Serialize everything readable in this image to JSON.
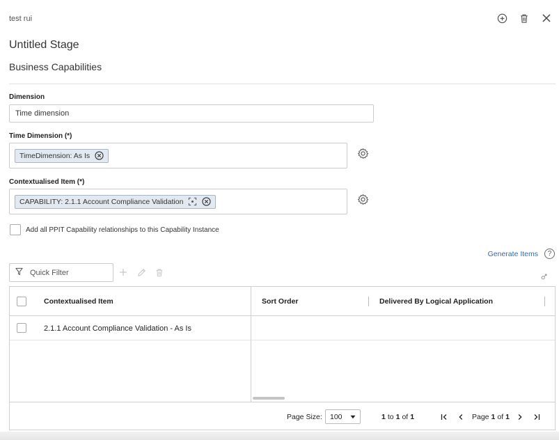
{
  "window": {
    "title": "test rui"
  },
  "header": {
    "stage_title": "Untitled Stage",
    "subtitle": "Business Capabilities"
  },
  "form": {
    "dimension": {
      "label": "Dimension",
      "value": "Time dimension"
    },
    "time_dimension": {
      "label": "Time Dimension (*)",
      "chip": "TimeDimension: As Is"
    },
    "contextualised_item": {
      "label": "Contextualised Item (*)",
      "chip": "CAPABILITY: 2.1.1 Account Compliance Validation"
    },
    "add_all_checkbox": {
      "label": "Add all PPIT Capability relationships to this Capability Instance",
      "checked": false
    }
  },
  "actions": {
    "generate_items": "Generate Items",
    "help": "?"
  },
  "toolbar": {
    "quick_filter_placeholder": "Quick Filter"
  },
  "grid": {
    "columns": [
      "Contextualised Item",
      "Sort Order",
      "Delivered By Logical Application"
    ],
    "rows": [
      {
        "contextualised_item": "2.1.1 Account Compliance Validation - As Is",
        "sort_order": "",
        "delivered_by": ""
      }
    ]
  },
  "pagination": {
    "page_size_label": "Page Size:",
    "page_size": "100",
    "range_from": "1",
    "range_to_word": "to",
    "range_to": "1",
    "of_word": "of",
    "total": "1",
    "page_word": "Page",
    "page": "1",
    "page_of_word": "of",
    "page_total": "1"
  },
  "colors": {
    "link": "#2b6cb0",
    "chip_bg": "#e3e9f1",
    "chip_border": "#a8b5c6"
  }
}
